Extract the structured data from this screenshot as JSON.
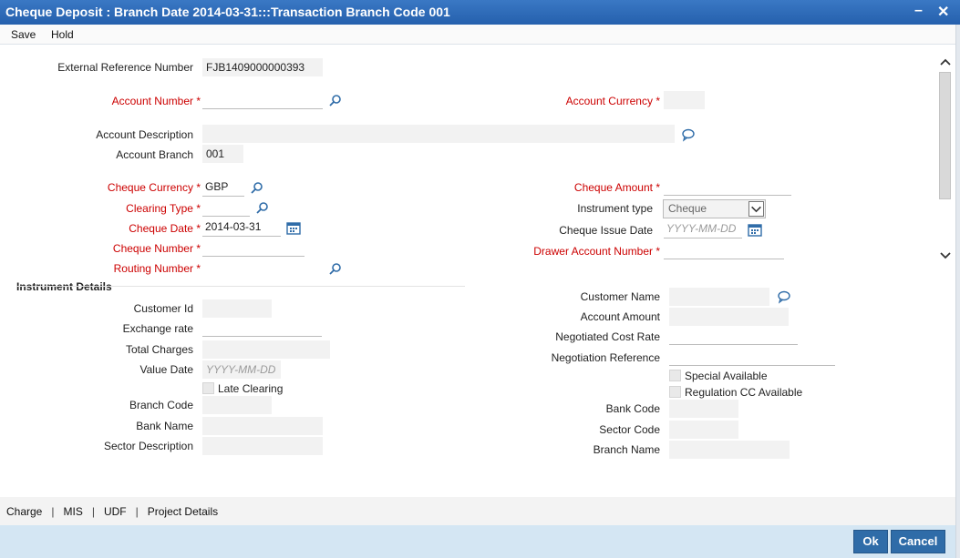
{
  "window": {
    "title": "Cheque Deposit : Branch Date 2014-03-31:::Transaction Branch Code 001",
    "minimize": "–",
    "close": "✕"
  },
  "menu": {
    "save": "Save",
    "hold": "Hold"
  },
  "form": {
    "external_reference_number": {
      "label": "External Reference Number",
      "value": "FJB1409000000393"
    },
    "account_number": {
      "label": "Account Number",
      "value": ""
    },
    "account_currency": {
      "label": "Account Currency",
      "value": ""
    },
    "account_description": {
      "label": "Account Description",
      "value": ""
    },
    "account_branch": {
      "label": "Account Branch",
      "value": "001"
    },
    "cheque_currency": {
      "label": "Cheque Currency",
      "value": "GBP"
    },
    "cheque_amount": {
      "label": "Cheque Amount",
      "value": ""
    },
    "clearing_type": {
      "label": "Clearing Type",
      "value": ""
    },
    "instrument_type": {
      "label": "Instrument type",
      "value": "Cheque"
    },
    "cheque_date": {
      "label": "Cheque Date",
      "value": "2014-03-31"
    },
    "cheque_issue_date": {
      "label": "Cheque Issue Date",
      "placeholder": "YYYY-MM-DD"
    },
    "cheque_number": {
      "label": "Cheque Number",
      "value": ""
    },
    "drawer_account_number": {
      "label": "Drawer Account Number",
      "value": ""
    },
    "routing_number": {
      "label": "Routing Number",
      "value": ""
    }
  },
  "instrument_details": {
    "heading": "Instrument Details",
    "customer_id": {
      "label": "Customer Id",
      "value": ""
    },
    "customer_name": {
      "label": "Customer Name",
      "value": ""
    },
    "exchange_rate": {
      "label": "Exchange rate",
      "value": ""
    },
    "account_amount": {
      "label": "Account Amount",
      "value": ""
    },
    "total_charges": {
      "label": "Total Charges",
      "value": ""
    },
    "negotiated_cost_rate": {
      "label": "Negotiated Cost Rate",
      "value": ""
    },
    "value_date": {
      "label": "Value Date",
      "placeholder": "YYYY-MM-DD"
    },
    "negotiation_reference": {
      "label": "Negotiation Reference",
      "value": ""
    },
    "special_available": {
      "label": "Special Available",
      "checked": false
    },
    "late_clearing": {
      "label": "Late Clearing",
      "checked": false
    },
    "regulation_cc_available": {
      "label": "Regulation CC Available",
      "checked": false
    },
    "branch_code": {
      "label": "Branch Code",
      "value": ""
    },
    "bank_code": {
      "label": "Bank Code",
      "value": ""
    },
    "bank_name": {
      "label": "Bank Name",
      "value": ""
    },
    "sector_code": {
      "label": "Sector Code",
      "value": ""
    },
    "sector_description": {
      "label": "Sector Description",
      "value": ""
    },
    "branch_name": {
      "label": "Branch Name",
      "value": ""
    }
  },
  "bottom_tabs": [
    "Charge",
    "MIS",
    "UDF",
    "Project Details"
  ],
  "tab_separator": "|",
  "buttons": {
    "ok": "Ok",
    "cancel": "Cancel"
  },
  "icons": {
    "search": "search-icon",
    "comment": "comment-icon",
    "calendar": "calendar-icon",
    "dropdown": "chevron-down-icon",
    "scroll_up": "chevron-up-icon",
    "scroll_down": "chevron-down-icon"
  },
  "colors": {
    "title_bar": "#2f6cb8",
    "required_label": "#cc0000",
    "button": "#2f6ca8",
    "footer": "#d4e6f3"
  }
}
